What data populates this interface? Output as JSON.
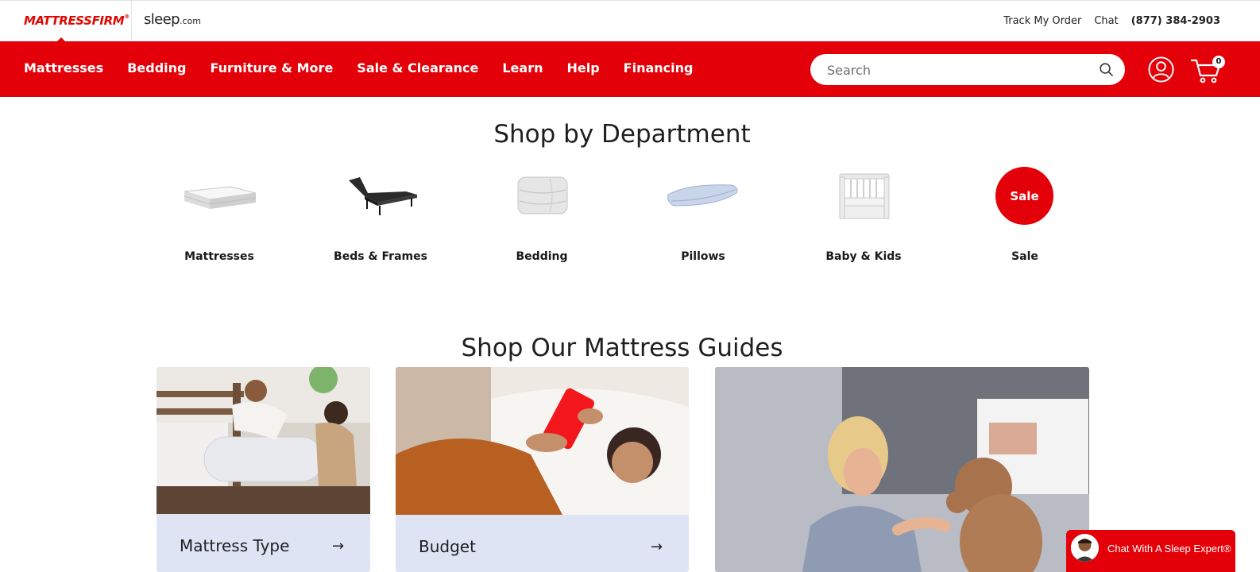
{
  "brand": {
    "logo_primary": "MATTRESSFIRM",
    "logo_secondary": "sleep",
    "logo_secondary_suffix": ".com"
  },
  "utility": {
    "track_order": "Track My Order",
    "chat": "Chat",
    "phone": "(877) 384-2903"
  },
  "nav": {
    "items": [
      "Mattresses",
      "Bedding",
      "Furniture & More",
      "Sale & Clearance",
      "Learn",
      "Help",
      "Financing"
    ],
    "search_placeholder": "Search",
    "cart_count": "0"
  },
  "departments": {
    "title": "Shop by Department",
    "items": [
      {
        "label": "Mattresses",
        "icon": "mattress-image"
      },
      {
        "label": "Beds & Frames",
        "icon": "adjustable-base-image"
      },
      {
        "label": "Bedding",
        "icon": "comforter-image"
      },
      {
        "label": "Pillows",
        "icon": "pillow-image"
      },
      {
        "label": "Baby & Kids",
        "icon": "crib-image"
      },
      {
        "label": "Sale",
        "badge": "Sale"
      }
    ]
  },
  "guides": {
    "title": "Shop Our Mattress Guides",
    "cards": [
      {
        "title": "Mattress Type",
        "arrow": "→"
      },
      {
        "title": "Budget",
        "arrow": "→"
      },
      {
        "title": ""
      }
    ]
  },
  "chat_widget": {
    "label": "Chat With A Sleep Expert®"
  },
  "colors": {
    "brand_red": "#e40008",
    "guide_footer": "#dfe4f5"
  }
}
